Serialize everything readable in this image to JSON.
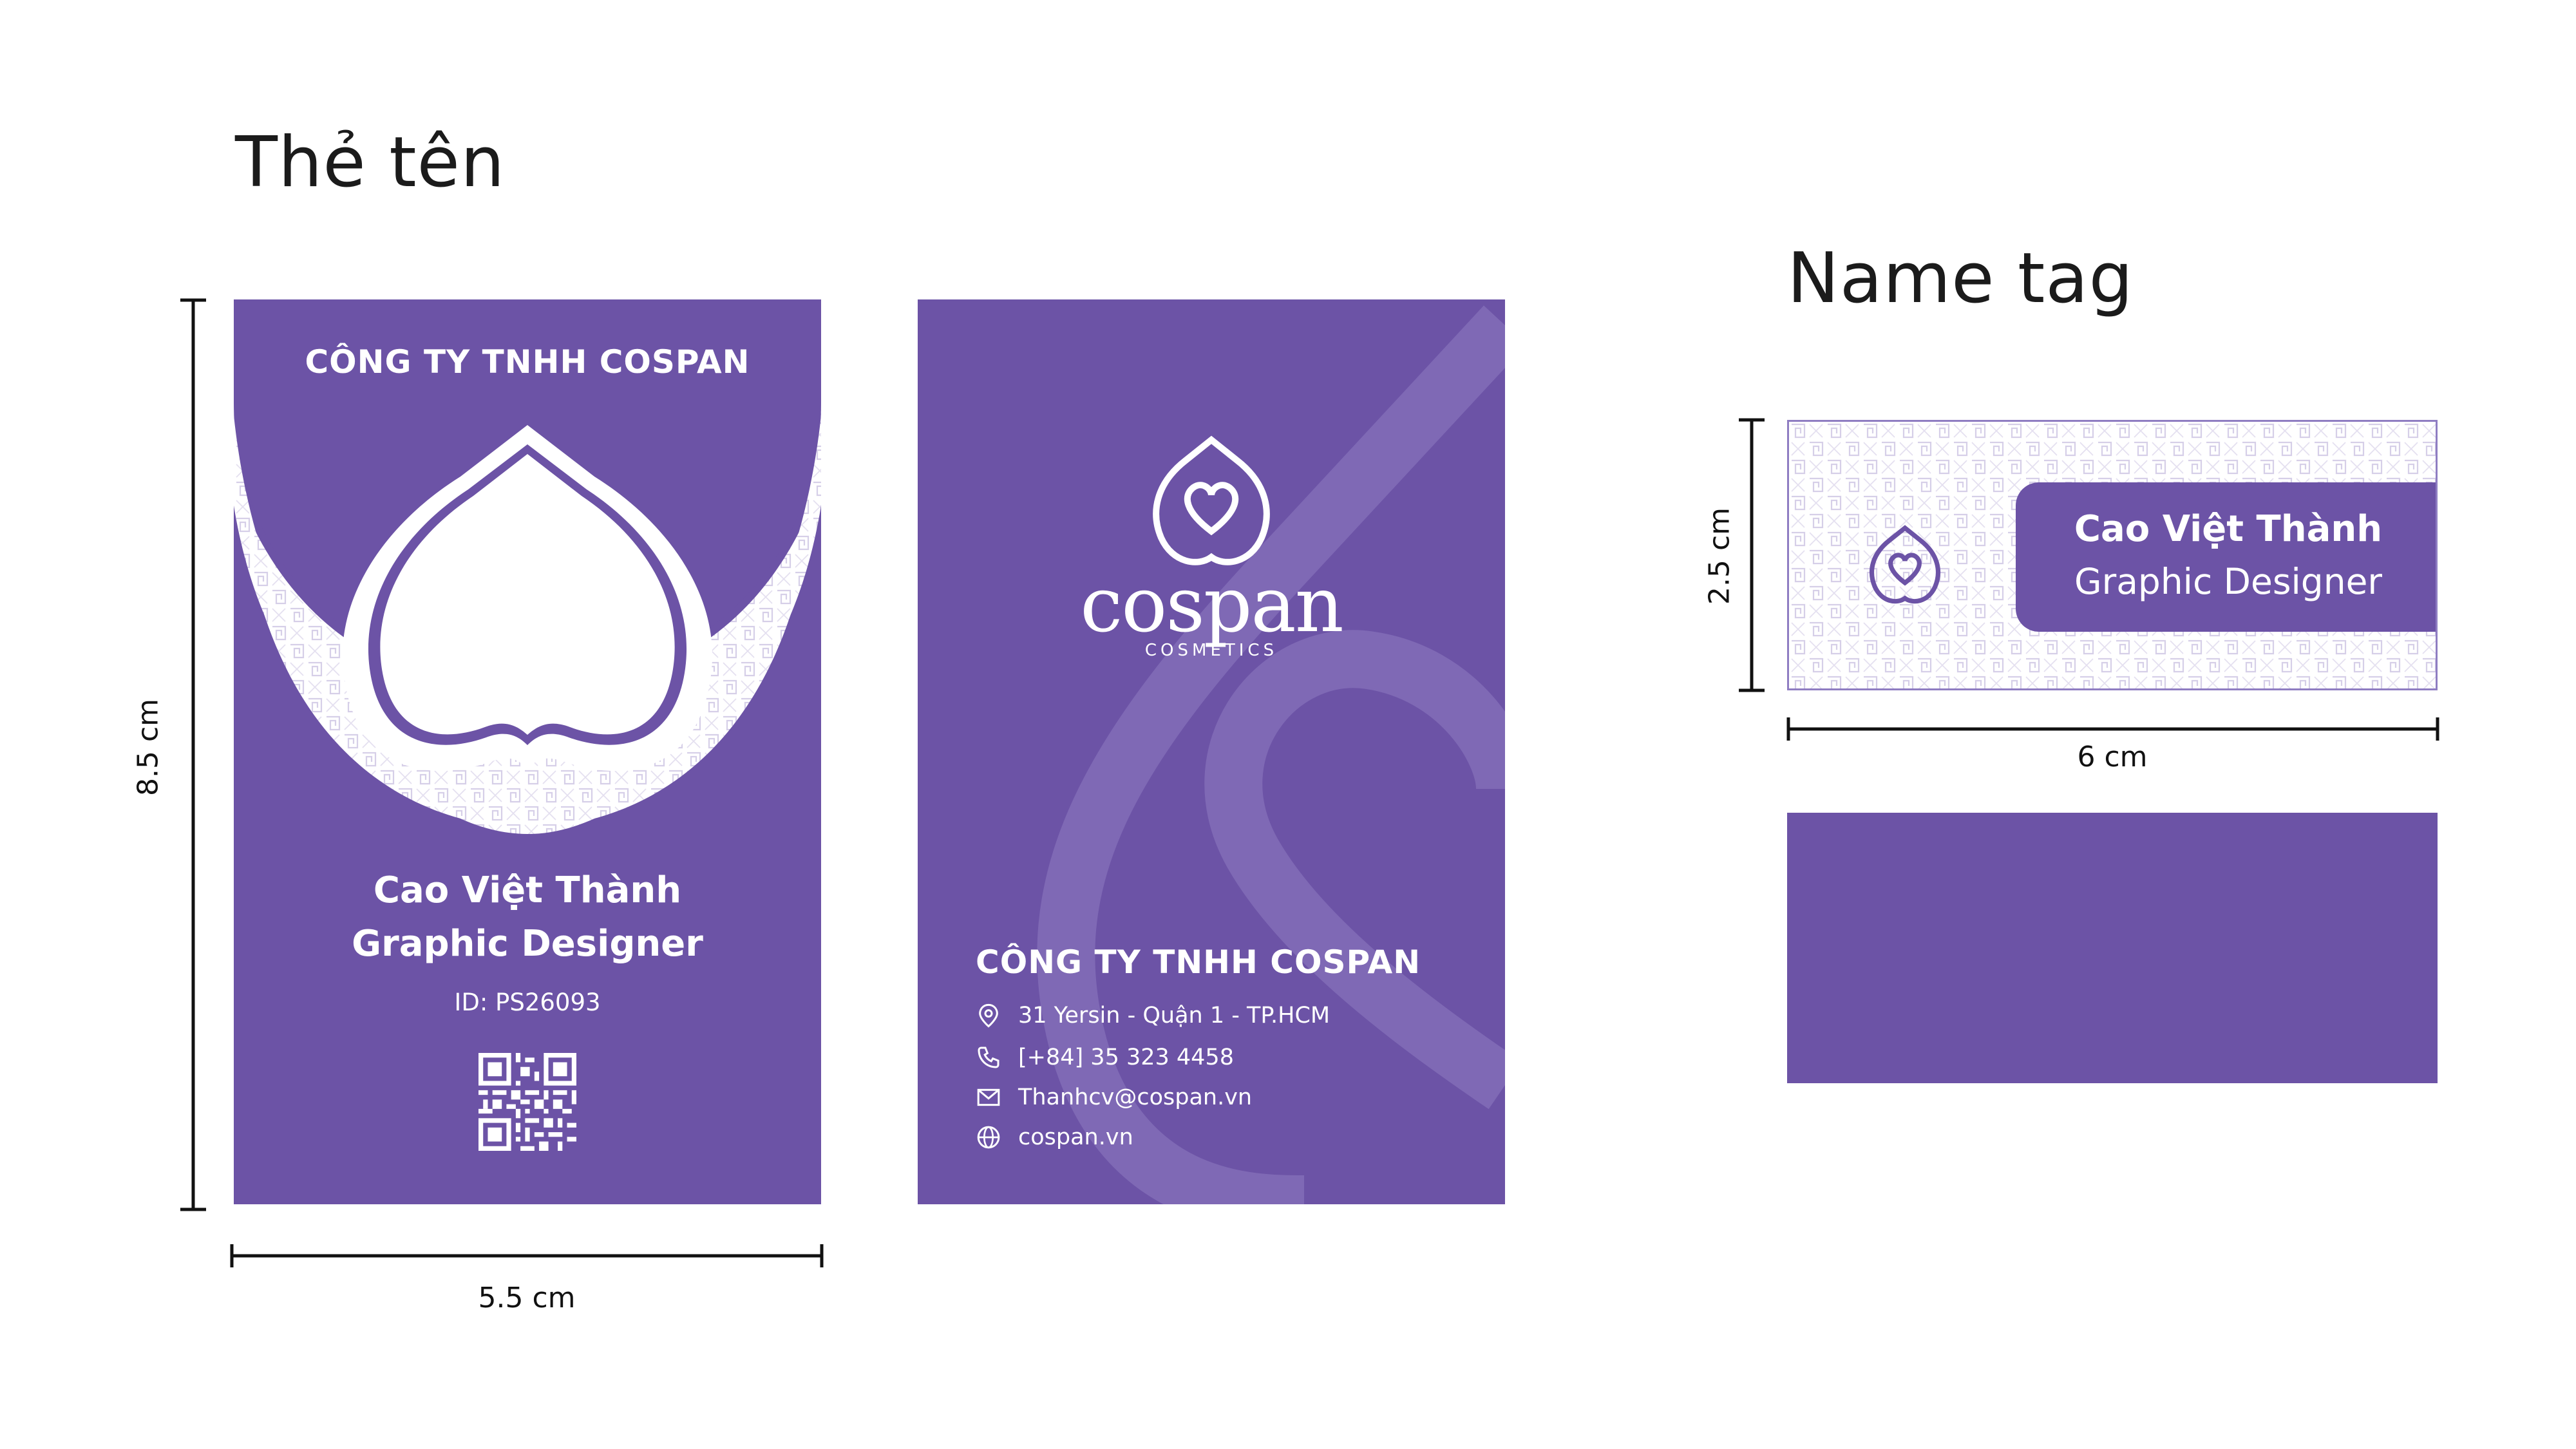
{
  "headings": {
    "left": "Thẻ tên",
    "right": "Name tag"
  },
  "dimensions": {
    "card_height": "8.5 cm",
    "card_width": "5.5 cm",
    "tag_height": "2.5 cm",
    "tag_width": "6 cm"
  },
  "card_front": {
    "company": "CÔNG TY TNHH COSPAN",
    "name": "Cao Việt Thành",
    "role": "Graphic Designer",
    "id": "ID: PS26093",
    "qr_icon": "qr-code-icon"
  },
  "card_back": {
    "brand": "cospan",
    "brand_sub": "COSMETICS",
    "company": "CÔNG TY TNHH COSPAN",
    "contacts": [
      {
        "icon": "location-pin-icon",
        "text": "31 Yersin - Quận 1 - TP.HCM"
      },
      {
        "icon": "phone-icon",
        "text": "[+84] 35 323 4458"
      },
      {
        "icon": "mail-icon",
        "text": "Thanhcv@cospan.vn"
      },
      {
        "icon": "globe-icon",
        "text": "cospan.vn"
      }
    ]
  },
  "name_tag": {
    "name": "Cao Việt Thành",
    "role": "Graphic Designer"
  },
  "colors": {
    "brand_purple": "#6c53a6",
    "pattern_line": "#d9d3ea",
    "white": "#ffffff"
  }
}
